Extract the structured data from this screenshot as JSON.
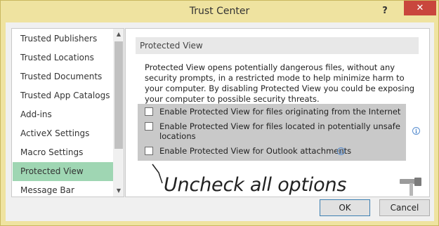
{
  "window": {
    "title": "Trust Center",
    "help_label": "?",
    "close_label": "✕"
  },
  "sidebar": {
    "items": [
      {
        "label": "Trusted Publishers"
      },
      {
        "label": "Trusted Locations"
      },
      {
        "label": "Trusted Documents"
      },
      {
        "label": "Trusted App Catalogs"
      },
      {
        "label": "Add-ins"
      },
      {
        "label": "ActiveX Settings"
      },
      {
        "label": "Macro Settings"
      },
      {
        "label": "Protected View",
        "selected": true
      },
      {
        "label": "Message Bar"
      }
    ],
    "scroll_up": "▲",
    "scroll_down": "▼"
  },
  "panel": {
    "header": "Protected View",
    "description": "Protected View opens potentially dangerous files, without any security prompts, in a restricted mode to help minimize harm to your computer. By disabling Protected View you could be exposing your computer to possible security threats.",
    "options": [
      {
        "label": "Enable Protected View for files originating from the Internet",
        "checked": false
      },
      {
        "label": "Enable Protected View for files located in potentially unsafe",
        "label_line2": "locations",
        "checked": false
      },
      {
        "label": "Enable Protected View for Outlook attachments",
        "checked": false
      }
    ],
    "info_glyph": "i",
    "annotation": "Uncheck all options"
  },
  "buttons": {
    "ok": "OK",
    "cancel": "Cancel"
  },
  "colors": {
    "title_bar": "#efe3a0",
    "selected_item": "#9fd6b3",
    "close_button": "#c9463d",
    "options_highlight": "#c9c9c9",
    "info_icon": "#5a8fd0"
  }
}
